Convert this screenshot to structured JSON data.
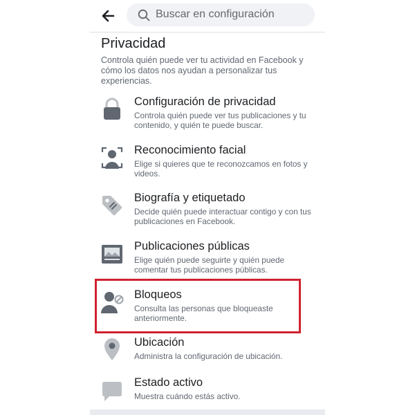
{
  "search": {
    "placeholder": "Buscar en configuración"
  },
  "section": {
    "title": "Privacidad",
    "description": "Controla quién puede ver tu actividad en Facebook y cómo los datos nos ayudan a personalizar tus experiencias."
  },
  "items": [
    {
      "title": "Configuración de privacidad",
      "description": "Controla quién puede ver tus publicaciones y tu contenido, y quién te puede buscar.",
      "icon": "lock-icon"
    },
    {
      "title": "Reconocimiento facial",
      "description": "Elige si quieres que te reconozcamos en fotos y videos.",
      "icon": "face-scan-icon"
    },
    {
      "title": "Biografía y etiquetado",
      "description": "Decide quién puede interactuar contigo y con tus publicaciones en Facebook.",
      "icon": "tag-icon"
    },
    {
      "title": "Publicaciones públicas",
      "description": "Elige quién puede seguirte y quién puede comentar tus publicaciones públicas.",
      "icon": "public-post-icon"
    },
    {
      "title": "Bloqueos",
      "description": "Consulta las personas que bloqueaste anteriormente.",
      "icon": "blocked-user-icon"
    },
    {
      "title": "Ubicación",
      "description": "Administra la configuración de ubicación.",
      "icon": "location-pin-icon"
    },
    {
      "title": "Estado activo",
      "description": "Muestra cuándo estás activo.",
      "icon": "chat-bubble-icon"
    }
  ],
  "colors": {
    "highlight": "#d0222e",
    "icon_gray": "#606770",
    "icon_light": "#bcc0c4"
  }
}
